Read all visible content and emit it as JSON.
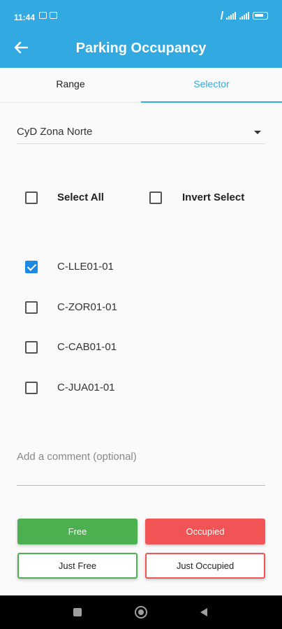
{
  "status_bar": {
    "time": "11:44"
  },
  "app_bar": {
    "title": "Parking Occupancy"
  },
  "tabs": [
    {
      "label": "Range",
      "selected": false
    },
    {
      "label": "Selector",
      "selected": true
    }
  ],
  "zone_dropdown": {
    "selected": "CyD Zona Norte"
  },
  "bulk": {
    "select_all": {
      "label": "Select All",
      "checked": false
    },
    "invert_select": {
      "label": "Invert Select",
      "checked": false
    }
  },
  "spots": [
    {
      "label": "C-LLE01-01",
      "checked": true
    },
    {
      "label": "C-ZOR01-01",
      "checked": false
    },
    {
      "label": "C-CAB01-01",
      "checked": false
    },
    {
      "label": "C-JUA01-01",
      "checked": false
    }
  ],
  "comment": {
    "placeholder": "Add a comment (optional)"
  },
  "actions": {
    "free": "Free",
    "occupied": "Occupied",
    "just_free": "Just Free",
    "just_occupied": "Just Occupied"
  },
  "colors": {
    "primary": "#32a9e1",
    "checkbox_checked": "#1e88e5",
    "free": "#4caf50",
    "occupied": "#f05454"
  }
}
